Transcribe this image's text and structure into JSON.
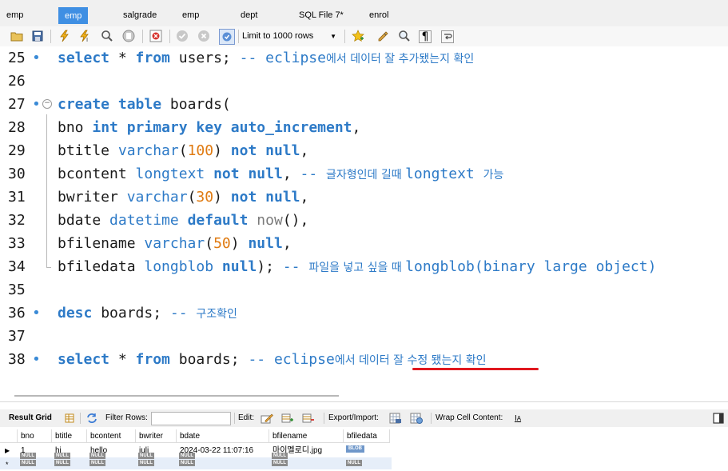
{
  "tabs": [
    {
      "label": "emp",
      "active": false
    },
    {
      "label": "emp",
      "active": true
    },
    {
      "label": "salgrade",
      "active": false
    },
    {
      "label": "emp",
      "active": false
    },
    {
      "label": "dept",
      "active": false
    },
    {
      "label": "SQL File 7*",
      "active": false
    },
    {
      "label": "enrol",
      "active": false
    }
  ],
  "toolbar": {
    "limit_label": "Limit to 1000 rows",
    "icons": [
      "open-folder-icon",
      "save-icon",
      "execute-icon",
      "execute-current-icon",
      "explain-icon",
      "stop-icon",
      "toggle-error-icon",
      "commit-icon",
      "rollback-icon",
      "autocommit-icon",
      "limit-dropdown",
      "beautify-icon",
      "find-icon",
      "invisible-chars-icon",
      "wrap-icon"
    ]
  },
  "editor": {
    "lines": [
      {
        "n": "25",
        "dot": true,
        "fold": false,
        "tokens": [
          [
            "kw",
            "select"
          ],
          [
            "id",
            " * "
          ],
          [
            "kw",
            "from"
          ],
          [
            "id",
            " users; "
          ],
          [
            "cm",
            "-- eclipse"
          ],
          [
            "cmk",
            "에서 데이터 잘 추가됐는지 확인"
          ]
        ]
      },
      {
        "n": "26",
        "dot": false,
        "fold": false,
        "tokens": []
      },
      {
        "n": "27",
        "dot": true,
        "fold": true,
        "tokens": [
          [
            "kw",
            "create"
          ],
          [
            "id",
            " "
          ],
          [
            "kw",
            "table"
          ],
          [
            "id",
            " boards("
          ]
        ]
      },
      {
        "n": "28",
        "dot": false,
        "fold": false,
        "tokens": [
          [
            "id",
            "bno "
          ],
          [
            "kw",
            "int"
          ],
          [
            "id",
            " "
          ],
          [
            "kw",
            "primary"
          ],
          [
            "id",
            " "
          ],
          [
            "kw",
            "key"
          ],
          [
            "id",
            " "
          ],
          [
            "kw",
            "auto_increment"
          ],
          [
            "id",
            ","
          ]
        ]
      },
      {
        "n": "29",
        "dot": false,
        "fold": false,
        "tokens": [
          [
            "id",
            "btitle "
          ],
          [
            "tp",
            "varchar"
          ],
          [
            "id",
            "("
          ],
          [
            "num",
            "100"
          ],
          [
            "id",
            ") "
          ],
          [
            "kw",
            "not"
          ],
          [
            "id",
            " "
          ],
          [
            "kw",
            "null"
          ],
          [
            "id",
            ","
          ]
        ]
      },
      {
        "n": "30",
        "dot": false,
        "fold": false,
        "tokens": [
          [
            "id",
            "bcontent "
          ],
          [
            "tp",
            "longtext"
          ],
          [
            "id",
            " "
          ],
          [
            "kw",
            "not"
          ],
          [
            "id",
            " "
          ],
          [
            "kw",
            "null"
          ],
          [
            "id",
            ", "
          ],
          [
            "cm",
            "-- "
          ],
          [
            "cmk",
            "글자형인데 길때 "
          ],
          [
            "cm",
            "longtext "
          ],
          [
            "cmk",
            "가능"
          ]
        ]
      },
      {
        "n": "31",
        "dot": false,
        "fold": false,
        "tokens": [
          [
            "id",
            "bwriter "
          ],
          [
            "tp",
            "varchar"
          ],
          [
            "id",
            "("
          ],
          [
            "num",
            "30"
          ],
          [
            "id",
            ") "
          ],
          [
            "kw",
            "not"
          ],
          [
            "id",
            " "
          ],
          [
            "kw",
            "null"
          ],
          [
            "id",
            ","
          ]
        ]
      },
      {
        "n": "32",
        "dot": false,
        "fold": false,
        "tokens": [
          [
            "id",
            "bdate "
          ],
          [
            "tp",
            "datetime"
          ],
          [
            "id",
            " "
          ],
          [
            "kw",
            "default"
          ],
          [
            "id",
            " "
          ],
          [
            "fn",
            "now"
          ],
          [
            "id",
            "(),"
          ]
        ]
      },
      {
        "n": "33",
        "dot": false,
        "fold": false,
        "tokens": [
          [
            "id",
            "bfilename "
          ],
          [
            "tp",
            "varchar"
          ],
          [
            "id",
            "("
          ],
          [
            "num",
            "50"
          ],
          [
            "id",
            ") "
          ],
          [
            "kw",
            "null"
          ],
          [
            "id",
            ","
          ]
        ]
      },
      {
        "n": "34",
        "dot": false,
        "fold": false,
        "tokens": [
          [
            "id",
            "bfiledata "
          ],
          [
            "tp",
            "longblob"
          ],
          [
            "id",
            " "
          ],
          [
            "kw",
            "null"
          ],
          [
            "id",
            "); "
          ],
          [
            "cm",
            "-- "
          ],
          [
            "cmk",
            "파일을 넣고 싶을 때 "
          ],
          [
            "cm",
            "longblob(binary large object)"
          ]
        ]
      },
      {
        "n": "35",
        "dot": false,
        "fold": false,
        "tokens": []
      },
      {
        "n": "36",
        "dot": true,
        "fold": false,
        "tokens": [
          [
            "kw",
            "desc"
          ],
          [
            "id",
            " boards; "
          ],
          [
            "cm",
            "-- "
          ],
          [
            "cmk",
            "구조확인"
          ]
        ]
      },
      {
        "n": "37",
        "dot": false,
        "fold": false,
        "tokens": []
      },
      {
        "n": "38",
        "dot": true,
        "fold": false,
        "tokens": [
          [
            "kw",
            "select"
          ],
          [
            "id",
            " * "
          ],
          [
            "kw",
            "from"
          ],
          [
            "id",
            " boards; "
          ],
          [
            "cm",
            "-- eclipse"
          ],
          [
            "cmk",
            "에서 데이터 잘 수정 됐는지 확인"
          ]
        ]
      }
    ]
  },
  "result_toolbar": {
    "result_grid": "Result Grid",
    "filter_rows": "Filter Rows:",
    "filter_value": "",
    "edit": "Edit:",
    "export_import": "Export/Import:",
    "wrap_cell": "Wrap Cell Content:"
  },
  "grid": {
    "columns": [
      "bno",
      "btitle",
      "bcontent",
      "bwriter",
      "bdate",
      "bfilename",
      "bfiledata"
    ],
    "rows": [
      [
        "1",
        "hi",
        "hello",
        "juli",
        "2024-03-22 11:07:16",
        "마이멜로디.jpg",
        "BLOB"
      ]
    ],
    "null_label": "NULL",
    "blob_label": "BLOB",
    "current_row_marker": "▶",
    "new_row_marker": "*"
  }
}
